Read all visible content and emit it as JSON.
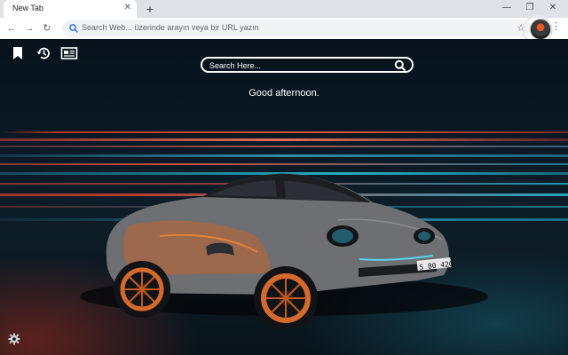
{
  "browser": {
    "tab_title": "New Tab",
    "tab_close": "✕",
    "new_tab": "+",
    "window_minimize": "—",
    "window_restore": "❐",
    "window_close": "✕",
    "back": "←",
    "forward": "→",
    "reload": "↻",
    "omnibox_placeholder": "Search Web... üzerinde arayın veya bir URL yazın",
    "bookmark_star": "☆",
    "menu": "⋮"
  },
  "newtab": {
    "search_placeholder": "Search Here...",
    "greeting": "Good afternoon.",
    "icons": [
      "bookmark-icon",
      "history-icon",
      "news-icon",
      "settings-icon"
    ],
    "license_plate": "S 80 420"
  },
  "colors": {
    "tabstrip": "#dee1e6",
    "omnibox": "#f1f3f4",
    "accent_red": "#d43a28",
    "accent_teal": "#1fb4c9",
    "text_white": "#ffffff"
  }
}
